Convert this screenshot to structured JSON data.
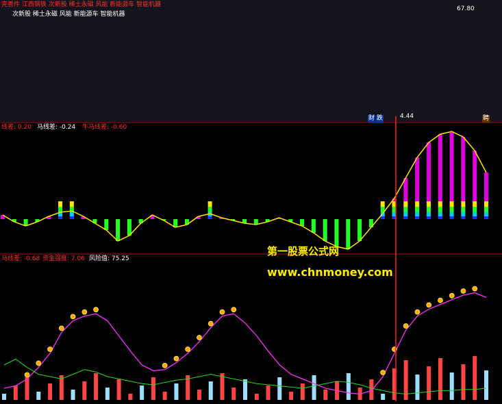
{
  "top_panel": {
    "line1": "完善件 江西钢铁 次新股 稀土永磁 风能 新能源车 智能机器",
    "line2": "次新股 稀土永磁 风能 新能源车 智能机器",
    "price_label": "67.80",
    "low_marker": "4.44",
    "bottom_tags": [
      "财",
      "跌"
    ],
    "right_tag": "聘"
  },
  "mid_panel": {
    "legend": [
      {
        "text": "线差: 0.20",
        "color": "#ff3030"
      },
      {
        "text": "马线差: -0.24",
        "color": "#ffffff"
      },
      {
        "text": "牛马线差: -0.60",
        "color": "#ff3030"
      }
    ]
  },
  "bottom_panel": {
    "legend": [
      {
        "text": "马线差: -0.68",
        "color": "#ff3030"
      },
      {
        "text": "资金强度: 7.06",
        "color": "#ff3030"
      },
      {
        "text": "风险值: 75.25",
        "color": "#ffffff"
      }
    ]
  },
  "watermark": {
    "line1": "第一股票公式网",
    "line2": "www.chnmoney.com"
  },
  "colors": {
    "up": "#ff3c3c",
    "down": "#00e5e5",
    "yellow": "#ffe500",
    "magenta": "#e000e0",
    "green_hist": "#22ff22",
    "cursor": "#ff2020"
  },
  "chart_data": [
    {
      "type": "candlestick",
      "title": "",
      "series": [
        {
          "name": "close",
          "values": [
            1.6,
            1.5,
            1.5,
            1.6,
            1.7,
            1.8,
            1.9,
            1.7,
            1.6,
            1.6,
            1.7,
            1.8,
            1.7,
            1.6,
            1.5,
            1.6,
            1.7,
            1.9,
            2.0,
            2.1,
            2.2,
            2.0,
            1.9,
            1.8,
            1.7,
            1.6,
            1.5,
            1.4,
            1.3,
            1.2,
            1.0,
            0.9,
            0.8,
            1.0,
            1.5,
            2.5,
            4.5,
            7.5,
            11,
            16,
            23,
            30,
            38,
            48,
            60,
            66
          ]
        }
      ]
    },
    {
      "type": "bar",
      "title": "",
      "series": [
        {
          "name": "oscillator",
          "values": [
            0.3,
            -0.2,
            -0.5,
            -0.2,
            0.2,
            0.5,
            0.6,
            0.2,
            -0.3,
            -0.8,
            -1.6,
            -1.2,
            -0.3,
            0.3,
            -0.1,
            -0.6,
            -0.4,
            0.2,
            0.4,
            0.1,
            -0.1,
            -0.3,
            -0.4,
            -0.2,
            0.1,
            -0.2,
            -0.5,
            -1.0,
            -1.6,
            -2.0,
            -2.2,
            -1.6,
            -0.6,
            0.4,
            1.5,
            3.0,
            4.5,
            5.6,
            6.2,
            6.4,
            6.0,
            5.0,
            3.4
          ]
        }
      ]
    },
    {
      "type": "bar",
      "title": "",
      "series": [
        {
          "name": "magenta_line",
          "values": [
            10,
            12,
            18,
            28,
            40,
            58,
            68,
            72,
            74,
            68,
            55,
            42,
            30,
            25,
            26,
            32,
            40,
            50,
            62,
            72,
            74,
            66,
            55,
            42,
            30,
            22,
            18,
            14,
            10,
            8,
            6,
            5,
            8,
            20,
            40,
            60,
            72,
            78,
            82,
            86,
            90,
            92,
            88
          ]
        },
        {
          "name": "green_line",
          "values": [
            30,
            35,
            28,
            22,
            20,
            18,
            22,
            26,
            24,
            20,
            18,
            16,
            14,
            13,
            15,
            17,
            18,
            20,
            22,
            20,
            18,
            16,
            14,
            13,
            12,
            11,
            10,
            12,
            14,
            16,
            15,
            13,
            10,
            8,
            6,
            5,
            6,
            7,
            8,
            8,
            9,
            9,
            10
          ]
        }
      ]
    }
  ]
}
